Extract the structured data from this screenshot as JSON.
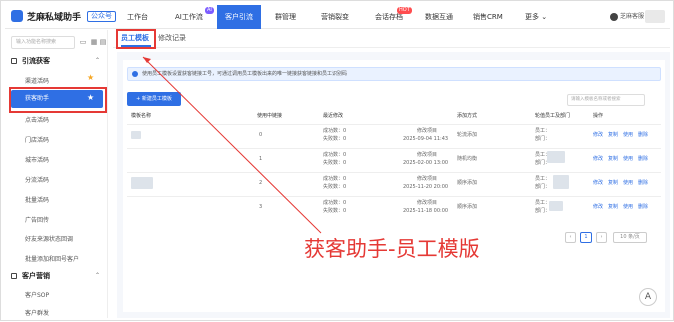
{
  "header": {
    "brand": "芝麻私域助手",
    "brand_tag": "公众号",
    "nav": [
      {
        "label": "工作台"
      },
      {
        "label": "AI工作流",
        "badge": "AI"
      },
      {
        "label": "客户引流",
        "active": true
      },
      {
        "label": "群管理"
      },
      {
        "label": "营销裂变"
      },
      {
        "label": "会话存档",
        "badge": "HOT"
      },
      {
        "label": "数据互通"
      },
      {
        "label": "销售CRM"
      },
      {
        "label": "更多 ⌄"
      }
    ],
    "user_label": "芝麻客服"
  },
  "sidebar": {
    "search_placeholder": "输入功能名称搜索",
    "groups": [
      {
        "title": "引流获客",
        "items": [
          {
            "label": "渠道活码"
          },
          {
            "label": "获客助手",
            "active": true
          },
          {
            "label": "点击活码"
          },
          {
            "label": "门店活码"
          },
          {
            "label": "城市活码"
          },
          {
            "label": "分流活码"
          },
          {
            "label": "批量活码"
          },
          {
            "label": "广告回传"
          },
          {
            "label": "好友来源状态回调"
          },
          {
            "label": "批量添加和回号客户"
          }
        ]
      },
      {
        "title": "客户营销",
        "items": [
          {
            "label": "客户SOP"
          },
          {
            "label": "客户群发"
          }
        ]
      }
    ]
  },
  "tabs": [
    {
      "label": "员工模板",
      "active": true
    },
    {
      "label": "修改记录"
    }
  ],
  "main": {
    "notice": "使用员工模板设置获客链接工号，可通过调用员工模板出来的唯一链接获客链接和员工识别码",
    "add_button": "+ 新建员工模板",
    "search_placeholder": "请输入模板名称或者搜索",
    "columns": [
      "模板名称",
      "使用中链接",
      "最近修改",
      "添加方式",
      "轮值员工及部门",
      "操作"
    ],
    "rows": [
      {
        "count": "0",
        "mod_lines": [
          "成功数：0",
          "失败数：0"
        ],
        "mod_user": "修改项目",
        "mod_time": "2025-09-04 11:43",
        "method": "轮流添加",
        "staff": [
          "员工：",
          "部门："
        ],
        "actions": [
          "修改",
          "复制",
          "使用",
          "删除"
        ]
      },
      {
        "count": "1",
        "mod_lines": [
          "成功数：0",
          "失败数：0"
        ],
        "mod_user": "修改项目",
        "mod_time": "2025-02-00 13:00",
        "method": "随机均衡",
        "staff": [
          "员工：",
          "部门："
        ],
        "actions": [
          "修改",
          "复制",
          "使用",
          "删除"
        ]
      },
      {
        "count": "2",
        "mod_lines": [
          "成功数：0",
          "失败数：0"
        ],
        "mod_user": "修改项目",
        "mod_time": "2025-11-20 20:00",
        "method": "顺序添加",
        "staff": [
          "员工：",
          "部门："
        ],
        "actions": [
          "修改",
          "复制",
          "使用",
          "删除"
        ]
      },
      {
        "count": "3",
        "mod_lines": [
          "成功数：0",
          "失败数：0"
        ],
        "mod_user": "修改项目",
        "mod_time": "2025-11-18 00:00",
        "method": "顺序添加",
        "staff": [
          "员工：",
          "部门："
        ],
        "actions": [
          "修改",
          "复制",
          "使用",
          "删除"
        ]
      }
    ],
    "pagination": {
      "prev": "‹",
      "current": "1",
      "next": "›",
      "page_size": "10 条/页"
    }
  },
  "overlay_caption": "获客助手-员工模版",
  "float_button": "A",
  "colors": {
    "primary": "#2f6fe4",
    "highlight": "#e53935"
  }
}
